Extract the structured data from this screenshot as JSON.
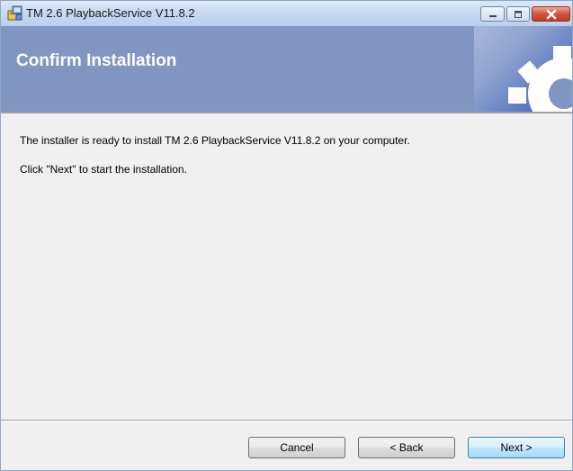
{
  "window": {
    "title": "TM 2.6 PlaybackService V11.8.2",
    "app_icon": "installer-icon"
  },
  "title_buttons": {
    "minimize": "minimize-icon",
    "maximize": "maximize-icon",
    "close": "close-icon"
  },
  "banner": {
    "title": "Confirm Installation",
    "art_icon": "gear-icon"
  },
  "body": {
    "message1": "The installer is ready to install TM 2.6 PlaybackService V11.8.2 on your computer.",
    "message2": "Click \"Next\" to start the installation."
  },
  "footer": {
    "cancel_label": "Cancel",
    "back_label": "< Back",
    "next_label": "Next >"
  },
  "colors": {
    "banner": "#8095c1",
    "background": "#f0f0f0",
    "close_button": "#c23a24"
  }
}
